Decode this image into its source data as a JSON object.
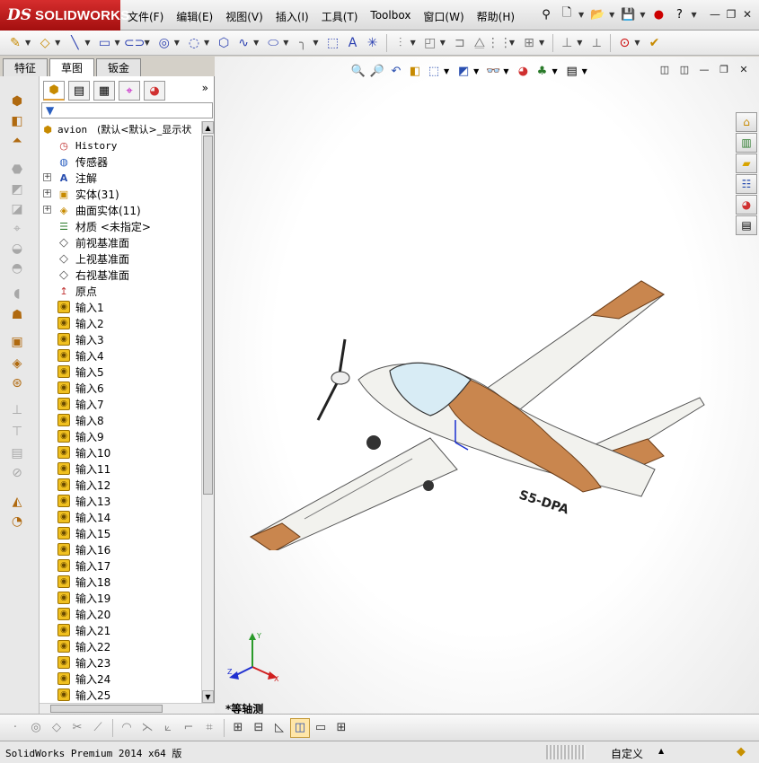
{
  "app": {
    "logo_prefix": "DS",
    "logo_text": "SOLIDWORKS"
  },
  "menu": [
    "文件(F)",
    "编辑(E)",
    "视图(V)",
    "插入(I)",
    "工具(T)",
    "Toolbox",
    "窗口(W)",
    "帮助(H)"
  ],
  "tabs": [
    "特征",
    "草图",
    "钣金"
  ],
  "active_tab": "草图",
  "tree": {
    "root_name": "avion",
    "root_config": "(默认<默认>_显示状",
    "history": "History",
    "sensors": "传感器",
    "annotations": "注解",
    "solid_bodies": "实体(31)",
    "surface_bodies": "曲面实体(11)",
    "material": "材质 <未指定>",
    "front_plane": "前视基准面",
    "top_plane": "上视基准面",
    "right_plane": "右视基准面",
    "origin": "原点",
    "imports": [
      "输入1",
      "输入2",
      "输入3",
      "输入4",
      "输入5",
      "输入6",
      "输入7",
      "输入8",
      "输入9",
      "输入10",
      "输入11",
      "输入12",
      "输入13",
      "输入14",
      "输入15",
      "输入16",
      "输入17",
      "输入18",
      "输入19",
      "输入20",
      "输入21",
      "输入22",
      "输入23",
      "输入24",
      "输入25"
    ]
  },
  "viewport": {
    "view_name": "*等轴测",
    "registration": "S5-DPA",
    "triad_axes": [
      "X",
      "Y",
      "Z"
    ]
  },
  "status": {
    "text": "SolidWorks Premium 2014 x64 版",
    "units": "自定义"
  },
  "colors": {
    "accent": "#c0392b",
    "plane_body": "#f2f2ee",
    "plane_trim": "#c9864e"
  }
}
